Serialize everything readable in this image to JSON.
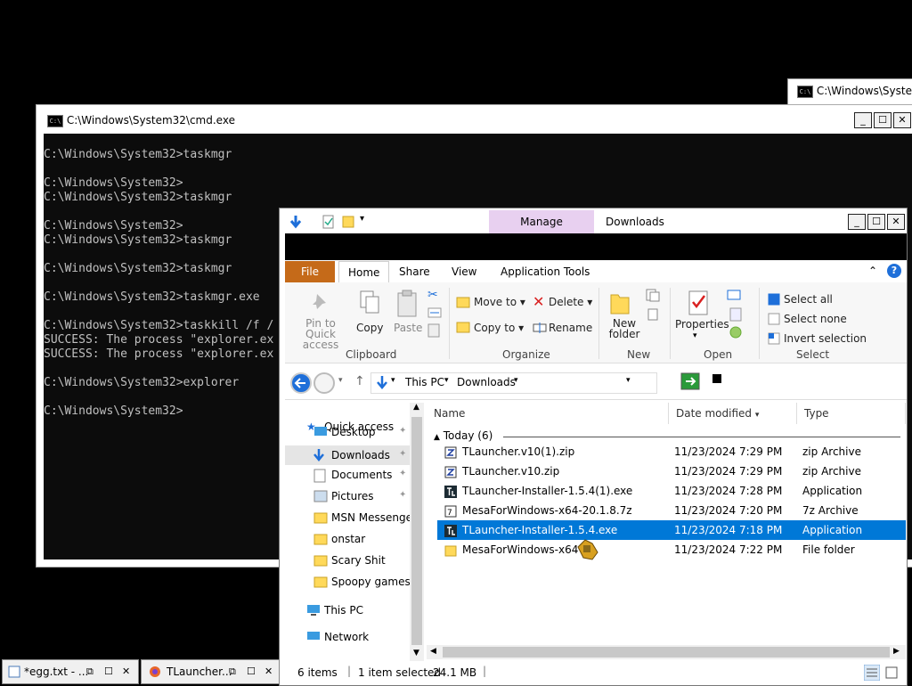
{
  "cmd_back": {
    "title": "C:\\Windows\\System"
  },
  "cmd": {
    "title": "C:\\Windows\\System32\\cmd.exe",
    "lines": [
      "C:\\Windows\\System32>taskmgr",
      "",
      "C:\\Windows\\System32>",
      "C:\\Windows\\System32>taskmgr",
      "",
      "C:\\Windows\\System32>",
      "C:\\Windows\\System32>taskmgr",
      "",
      "C:\\Windows\\System32>taskmgr",
      "",
      "C:\\Windows\\System32>taskmgr.exe",
      "",
      "C:\\Windows\\System32>taskkill /f /",
      "SUCCESS: The process \"explorer.ex",
      "SUCCESS: The process \"explorer.ex",
      "",
      "C:\\Windows\\System32>explorer",
      "",
      "C:\\Windows\\System32>"
    ]
  },
  "explorer": {
    "manage": "Manage",
    "title": "Downloads",
    "tabs": {
      "file": "File",
      "home": "Home",
      "share": "Share",
      "view": "View",
      "app_tools": "Application Tools"
    },
    "ribbon": {
      "pin": "Pin to Quick access",
      "copy": "Copy",
      "paste": "Paste",
      "clipboard": "Clipboard",
      "move_to": "Move to",
      "copy_to": "Copy to",
      "delete": "Delete",
      "rename": "Rename",
      "organize": "Organize",
      "new_folder": "New folder",
      "new": "New",
      "properties": "Properties",
      "open": "Open",
      "select_all": "Select all",
      "select_none": "Select none",
      "invert_selection": "Invert selection",
      "select": "Select"
    },
    "address": {
      "this_pc": "This PC",
      "downloads": "Downloads"
    },
    "nav": {
      "quick_access": "Quick access",
      "desktop": "Desktop",
      "downloads": "Downloads",
      "documents": "Documents",
      "pictures": "Pictures",
      "msn": "MSN Messenger",
      "onstar": "onstar",
      "scary": "Scary Shit",
      "spoopy": "Spoopy games",
      "this_pc": "This PC",
      "network": "Network"
    },
    "columns": {
      "name": "Name",
      "date": "Date modified",
      "type": "Type"
    },
    "group": "Today (6)",
    "files": [
      {
        "name": "TLauncher.v10(1).zip",
        "date": "11/23/2024 7:29 PM",
        "type": "zip Archive"
      },
      {
        "name": "TLauncher.v10.zip",
        "date": "11/23/2024 7:29 PM",
        "type": "zip Archive"
      },
      {
        "name": "TLauncher-Installer-1.5.4(1).exe",
        "date": "11/23/2024 7:28 PM",
        "type": "Application"
      },
      {
        "name": "MesaForWindows-x64-20.1.8.7z",
        "date": "11/23/2024 7:20 PM",
        "type": "7z Archive"
      },
      {
        "name": "TLauncher-Installer-1.5.4.exe",
        "date": "11/23/2024 7:18 PM",
        "type": "Application"
      },
      {
        "name": "MesaForWindows-x64-20.1.8",
        "date": "11/23/2024 7:22 PM",
        "type": "File folder"
      }
    ],
    "status": {
      "items": "6 items",
      "selected": "1 item selected",
      "size": "24.1 MB"
    }
  },
  "taskbar": {
    "egg": "*egg.txt - ...",
    "tlauncher": "TLauncher..."
  }
}
